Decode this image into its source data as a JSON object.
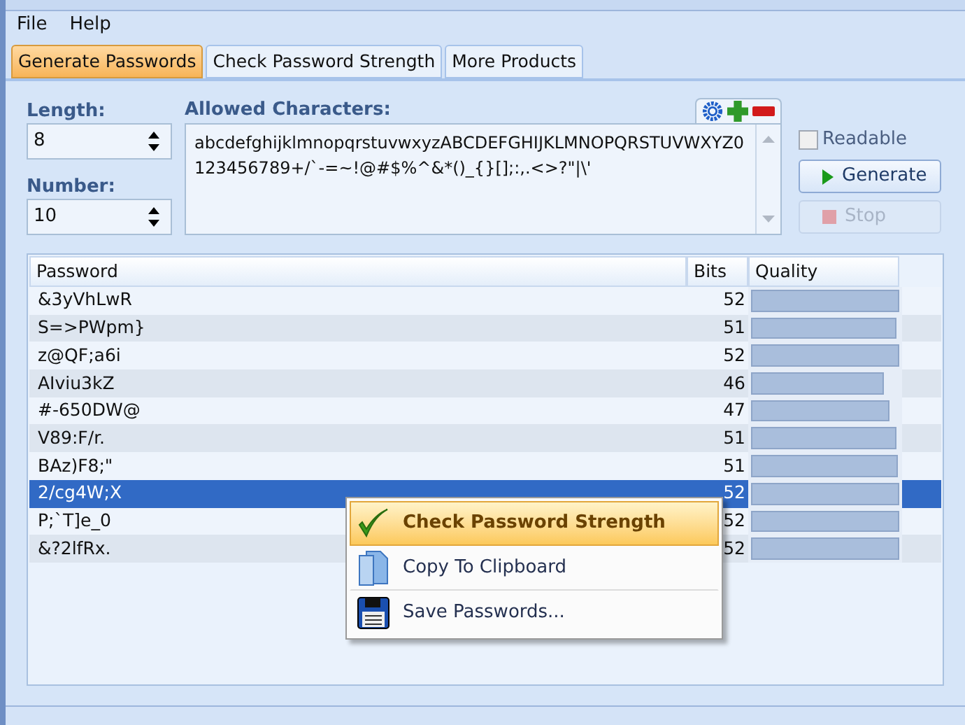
{
  "menu": [
    "File",
    "Help"
  ],
  "tabs": [
    {
      "label": "Generate Passwords",
      "selected": true
    },
    {
      "label": "Check Password Strength",
      "selected": false
    },
    {
      "label": "More Products",
      "selected": false
    }
  ],
  "length": {
    "label": "Length:",
    "value": "8"
  },
  "number": {
    "label": "Number:",
    "value": "10"
  },
  "allowed": {
    "label": "Allowed Characters:",
    "value": "abcdefghijklmnopqrstuvwxyzABCDEFGHIJKLMNOPQRSTUVWXYZ0123456789+/`-=~!@#$%^&*()_{}[];:,.<>?\"|\\'"
  },
  "readable": {
    "label": "Readable",
    "checked": false
  },
  "generate": {
    "label": "Generate",
    "disabled": false
  },
  "stop": {
    "label": "Stop",
    "disabled": true
  },
  "table": {
    "columns": [
      "Password",
      "Bits",
      "Quality"
    ],
    "rows": [
      {
        "password": "&3yVhLwR",
        "bits": "52",
        "level": 1,
        "selected": false
      },
      {
        "password": "S=>PWpm}",
        "bits": "51",
        "level": 0.98,
        "selected": false
      },
      {
        "password": "z@QF;a6i",
        "bits": "52",
        "level": 1,
        "selected": false
      },
      {
        "password": "AIviu3kZ",
        "bits": "46",
        "level": 0.9,
        "selected": false
      },
      {
        "password": "#-650DW@",
        "bits": "47",
        "level": 0.93,
        "selected": false
      },
      {
        "password": "V89:F/r.",
        "bits": "51",
        "level": 0.98,
        "selected": false
      },
      {
        "password": "BAz)F8;\"",
        "bits": "51",
        "level": 0.99,
        "selected": false
      },
      {
        "password": "2/cg4W;X",
        "bits": "52",
        "level": 1,
        "selected": true
      },
      {
        "password": "P;`T]e_0",
        "bits": "52",
        "level": 1,
        "selected": false
      },
      {
        "password": "&?2lfRx.",
        "bits": "52",
        "level": 1,
        "selected": false
      }
    ]
  },
  "context_menu": [
    {
      "label": "Check Password Strength",
      "kind": "check",
      "selected": true
    },
    {
      "label": "Copy To Clipboard",
      "kind": "copy",
      "selected": false
    },
    {
      "label": "Save Passwords...",
      "kind": "save",
      "selected": false
    }
  ]
}
